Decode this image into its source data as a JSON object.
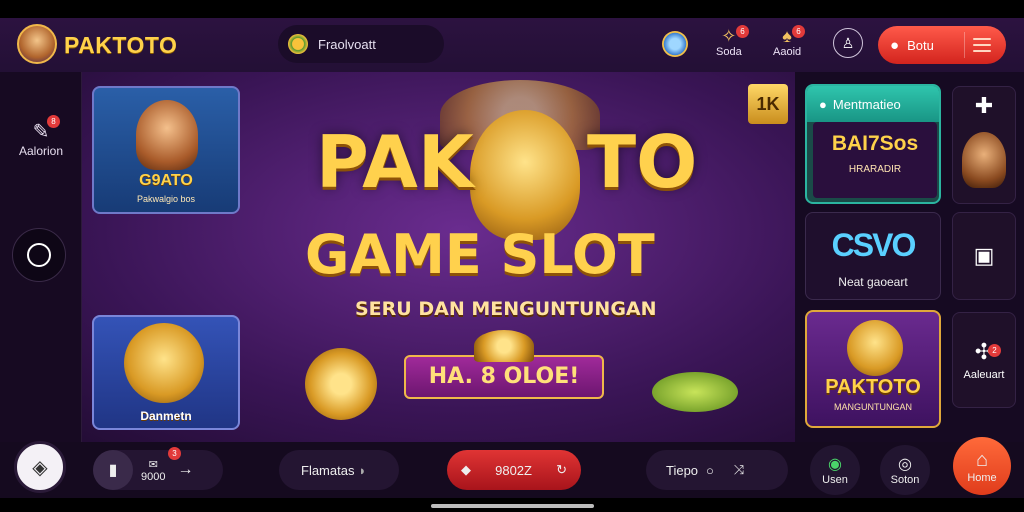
{
  "header": {
    "brand": "PAKTOTO",
    "search_value": "Fraolvoatt",
    "icons": [
      {
        "name": "coin-icon"
      },
      {
        "name": "soda-icon",
        "label": "Soda",
        "badge": "6"
      },
      {
        "name": "acoid-icon",
        "label": "Aaoid",
        "badge": "6"
      }
    ],
    "action_label": "Botu"
  },
  "left_rail": {
    "item_label": "Aalorion",
    "item_badge": "8"
  },
  "left_cards": [
    {
      "title": "G9ATO",
      "sub": "Pakwalgio bos"
    },
    {
      "title": "Danmetn"
    }
  ],
  "hero": {
    "title_line1_left": "PAK",
    "title_line1_right": "TO",
    "title_line2": "GAME SLOT",
    "subtitle": "SERU DAN MENGUNTUNGAN",
    "ribbon": "HA. 8 OLOE!",
    "k_box": "1K"
  },
  "right_tiles": {
    "tile1_header": "Mentmatieo",
    "tile1_big": "BAI7Sos",
    "tile1_small": "HRARADIR",
    "tile2_logo": "CSVO",
    "tile2_label": "Neat gaoeart",
    "tile3_title": "PAKTOTO",
    "tile3_sub": "MANGUNTUNGAN",
    "side_labels": {
      "side3": "Aaleuart",
      "side3_badge": "2"
    }
  },
  "bottom": {
    "wallet_amount": "9000",
    "wallet_badge": "3",
    "filter_label": "Flamatas",
    "bet_label": "9802Z",
    "tiepo_label": "Tiepo",
    "btn_usen": "Usen",
    "btn_soton": "Soton",
    "btn_home": "Home"
  },
  "colors": {
    "brand_gold": "#ffd24a",
    "accent_red": "#e23a3a",
    "teal": "#2bb5a0",
    "background_purple": "#3a1556"
  }
}
